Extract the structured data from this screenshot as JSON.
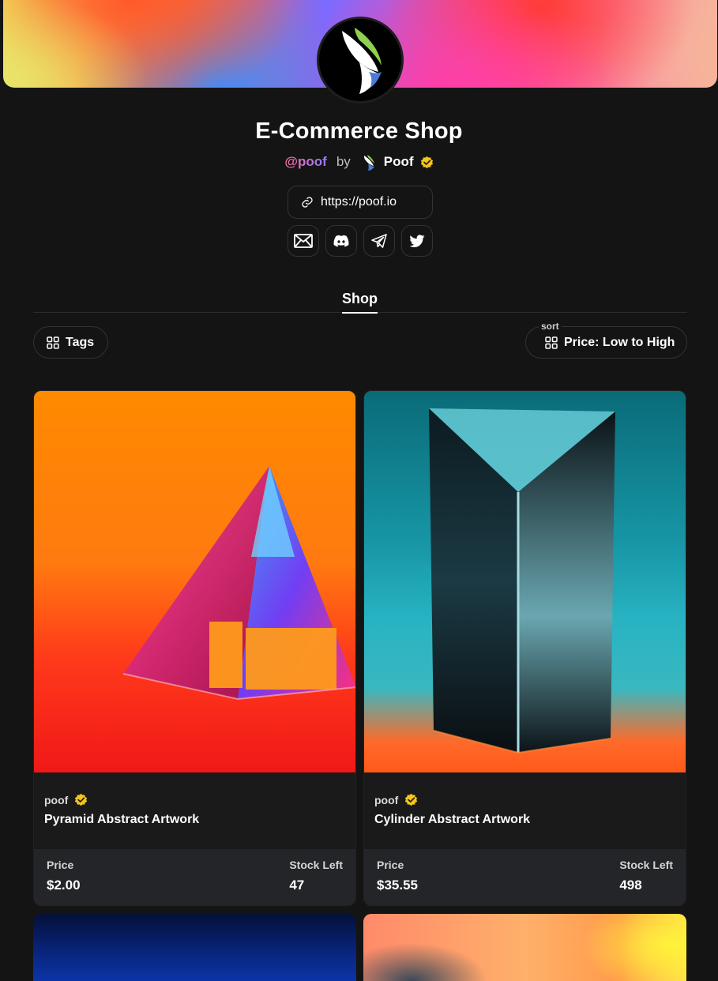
{
  "header": {
    "title": "E-Commerce Shop",
    "handle": "@poof",
    "by": "by",
    "owner": "Poof",
    "url": "https://poof.io"
  },
  "socials": [
    {
      "icon": "mail-icon"
    },
    {
      "icon": "discord-icon"
    },
    {
      "icon": "telegram-icon"
    },
    {
      "icon": "twitter-icon"
    }
  ],
  "tabs": {
    "shop": "Shop"
  },
  "filters": {
    "tags_label": "Tags",
    "sort_caption": "sort",
    "sort_value": "Price: Low to High"
  },
  "colors": {
    "background": "#141414",
    "card_footer": "#242528",
    "verified": "#f5c518",
    "handle_gradient_start": "#ff6aa0",
    "handle_gradient_end": "#8f7cff"
  },
  "products": [
    {
      "seller": "poof",
      "title": "Pyramid Abstract Artwork",
      "price_label": "Price",
      "price": "$2.00",
      "stock_label": "Stock Left",
      "stock": "47"
    },
    {
      "seller": "poof",
      "title": "Cylinder Abstract Artwork",
      "price_label": "Price",
      "price": "$35.55",
      "stock_label": "Stock Left",
      "stock": "498"
    }
  ]
}
